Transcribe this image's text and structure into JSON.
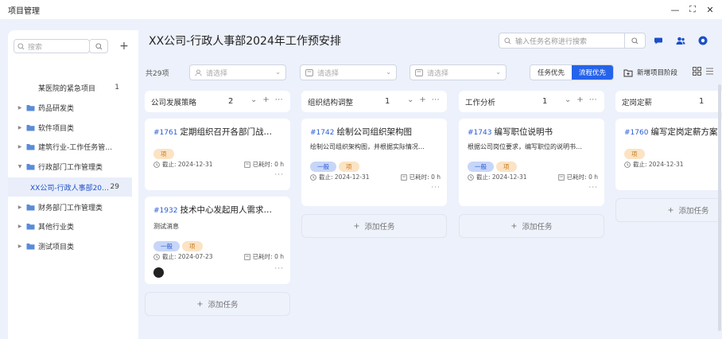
{
  "window": {
    "title": "项目管理",
    "controls": [
      "—",
      "⛶",
      "✕"
    ]
  },
  "sidebar": {
    "search_placeholder": "搜索",
    "add_label": "+",
    "items": [
      {
        "label": "某医院的紧急项目",
        "count": "1",
        "type": "project"
      },
      {
        "label": "药品研发类",
        "type": "folder"
      },
      {
        "label": "软件项目类",
        "type": "folder"
      },
      {
        "label": "建筑行业-工作任务管…",
        "type": "folder"
      },
      {
        "label": "行政部门工作管理类",
        "type": "folder",
        "expanded": true
      },
      {
        "label": "XX公司-行政人事部20…",
        "count": "29",
        "type": "project",
        "active": true
      },
      {
        "label": "财务部门工作管理类",
        "type": "folder"
      },
      {
        "label": "其他行业类",
        "type": "folder"
      },
      {
        "label": "测试项目类",
        "type": "folder"
      }
    ]
  },
  "header": {
    "title": "XX公司-行政人事部2024年工作预安排",
    "search_placeholder": "输入任务名称进行搜索"
  },
  "toolbar": {
    "total": "共29项",
    "filters": [
      "请选择",
      "请选择",
      "请选择"
    ],
    "segment": [
      "任务优先",
      "流程优先"
    ],
    "segment_active": 1,
    "add_stage": "新增项目阶段"
  },
  "columns": [
    {
      "name": "公司发展策略",
      "count": "2",
      "cards": [
        {
          "id": "#1761",
          "title": "定期组织召开各部门战…",
          "desc": "",
          "tags": [
            "项"
          ],
          "tag_colors": [
            "orange"
          ],
          "deadline": "截止: 2024-12-31",
          "spent": "已耗时: 0 h"
        },
        {
          "id": "#1932",
          "title": "技术中心发起用人需求…",
          "desc": "测试消息",
          "tags": [
            "一般",
            "项"
          ],
          "tag_colors": [
            "blue",
            "orange"
          ],
          "deadline": "截止: 2024-07-23",
          "spent": "已耗时: 0 h",
          "avatar": true
        }
      ],
      "add_label": "添加任务"
    },
    {
      "name": "组织结构调整",
      "count": "1",
      "cards": [
        {
          "id": "#1742",
          "title": "绘制公司组织架构图",
          "desc": "绘制公司组织架构图，并根据实际情况…",
          "tags": [
            "一般",
            "项"
          ],
          "tag_colors": [
            "blue",
            "orange"
          ],
          "deadline": "截止: 2024-12-31",
          "spent": "已耗时: 0 h"
        }
      ],
      "add_label": "添加任务"
    },
    {
      "name": "工作分析",
      "count": "1",
      "cards": [
        {
          "id": "#1743",
          "title": "编写职位说明书",
          "desc": "根据公司岗位要求，编写职位的说明书…",
          "tags": [
            "一般",
            "项"
          ],
          "tag_colors": [
            "blue",
            "orange"
          ],
          "deadline": "截止: 2024-12-31",
          "spent": "已耗时: 0 h"
        }
      ],
      "add_label": "添加任务"
    },
    {
      "name": "定岗定薪",
      "count": "1",
      "cards": [
        {
          "id": "#1760",
          "title": "编写定岗定薪方案",
          "desc": "",
          "tags": [
            "项"
          ],
          "tag_colors": [
            "orange"
          ],
          "deadline": "截止: 2024-12-31",
          "spent": ""
        }
      ],
      "add_label": "添加任务"
    }
  ],
  "colors": {
    "accent": "#2563eb",
    "bg": "#edf1fb",
    "id": "#2a5bd7"
  }
}
